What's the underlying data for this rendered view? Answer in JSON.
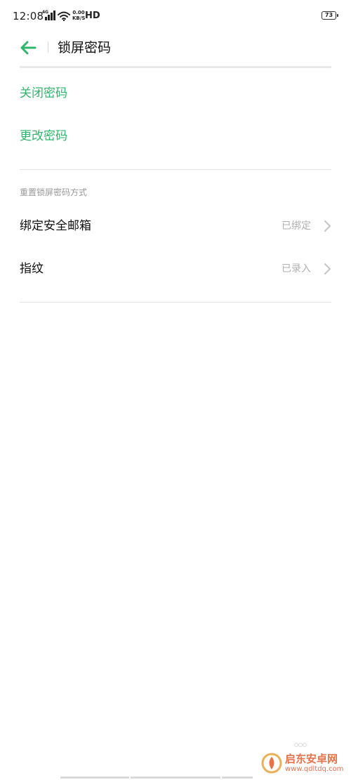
{
  "status_bar": {
    "time": "12:08",
    "network_label": "4G",
    "speed_value": "0.00",
    "speed_unit": "KB/S",
    "hd_label": "HD",
    "battery_level": "73"
  },
  "header": {
    "title": "锁屏密码"
  },
  "options": {
    "close_password": "关闭密码",
    "change_password": "更改密码"
  },
  "reset_section": {
    "title": "重置锁屏密码方式",
    "items": [
      {
        "label": "绑定安全邮箱",
        "status": "已绑定"
      },
      {
        "label": "指纹",
        "status": "已录入"
      }
    ]
  },
  "watermark": {
    "title": "启东安卓网",
    "url": "www.qdltdq.com"
  },
  "colors": {
    "accent_green": "#2eb66a",
    "text_primary": "#111111",
    "text_secondary": "#b0b0b0",
    "divider": "#e6e6e6",
    "watermark_orange": "#e25a2a"
  }
}
